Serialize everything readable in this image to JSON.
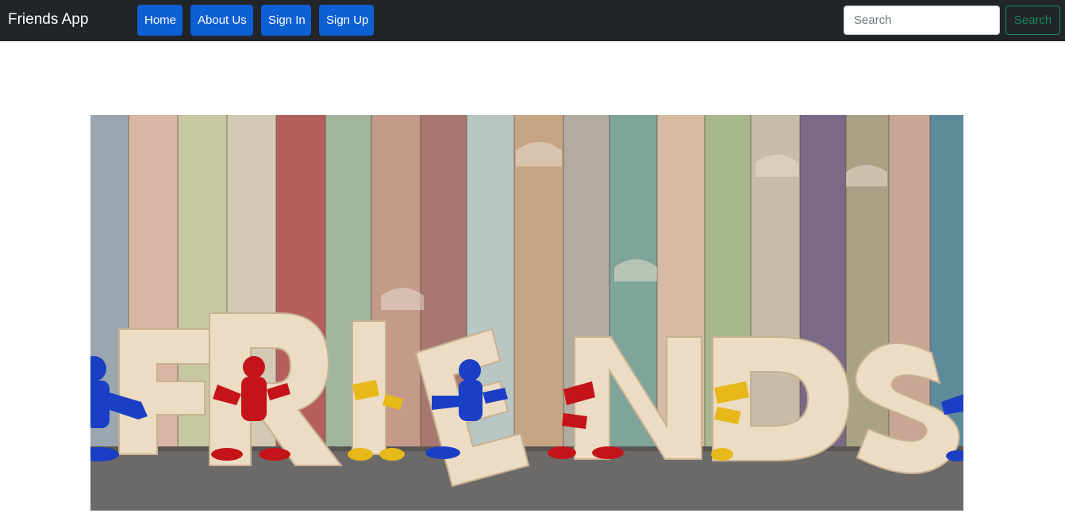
{
  "navbar": {
    "brand": "Friends App",
    "links": [
      {
        "label": "Home"
      },
      {
        "label": "About Us"
      },
      {
        "label": "Sign In"
      },
      {
        "label": "Sign Up"
      }
    ],
    "search": {
      "placeholder": "Search",
      "value": "",
      "button_label": "Search"
    }
  },
  "hero": {
    "image_subject": "wooden-letters-friends-banner",
    "letters": "FRIENDS",
    "colors": {
      "link_button": "#0d5fd4",
      "search_button": "#198754",
      "navbar": "#212529"
    }
  }
}
